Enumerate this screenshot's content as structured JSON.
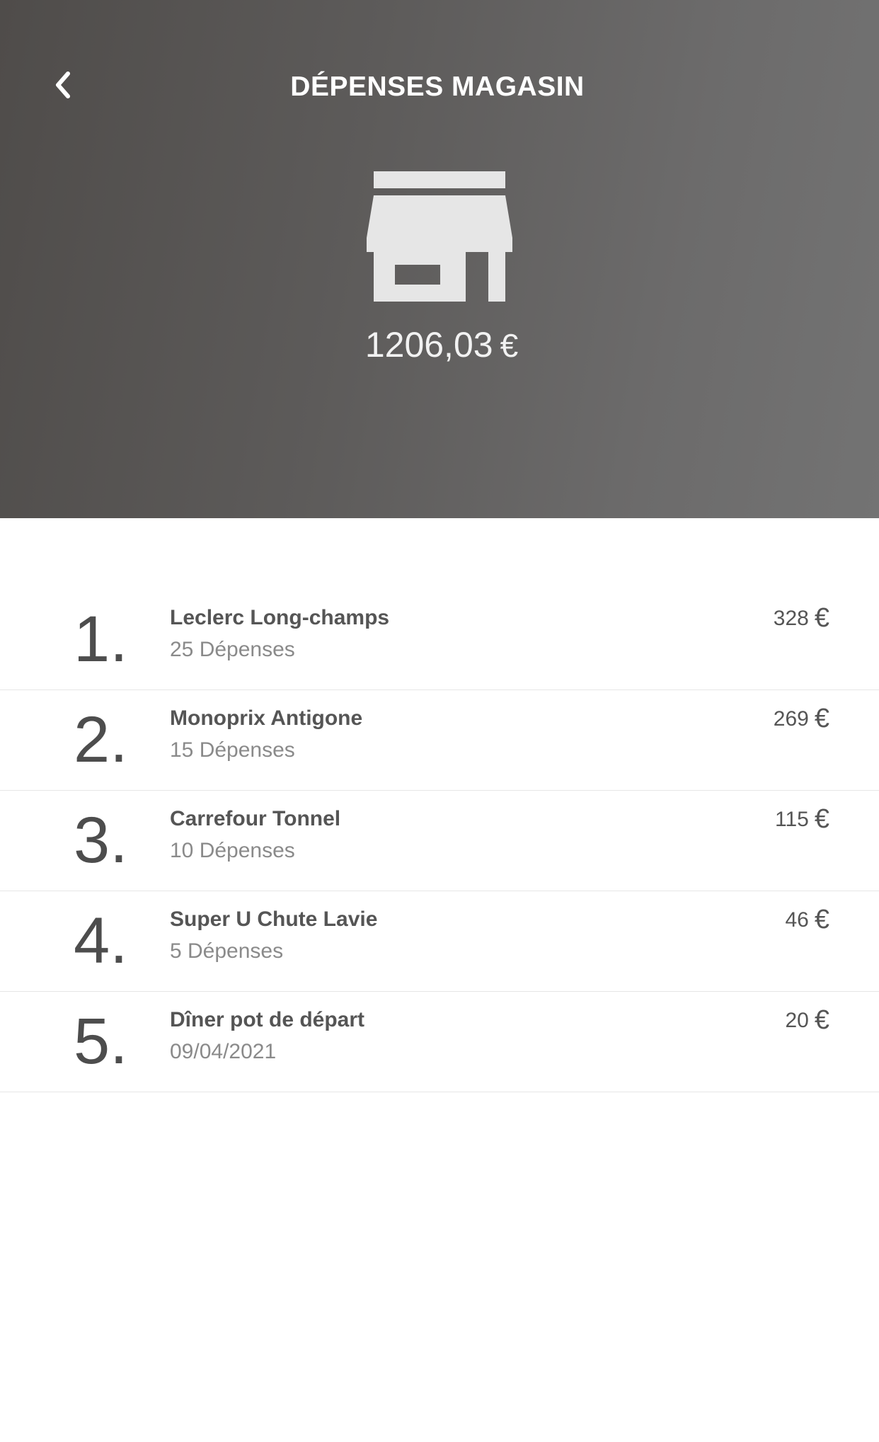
{
  "header": {
    "title": "DÉPENSES MAGASIN",
    "total_value": "1206,03",
    "currency": "€",
    "icons": {
      "back": "chevron-left-icon",
      "store": "store-icon"
    },
    "colors": {
      "gradient_start": "#4f4c4a",
      "gradient_end": "#737373",
      "icon": "#e6e6e6"
    }
  },
  "stores": [
    {
      "rank": "1.",
      "name": "Leclerc Long-champs",
      "subtitle": "25 Dépenses",
      "amount": "328",
      "currency": "€"
    },
    {
      "rank": "2.",
      "name": "Monoprix Antigone",
      "subtitle": "15 Dépenses",
      "amount": "269",
      "currency": "€"
    },
    {
      "rank": "3.",
      "name": "Carrefour Tonnel",
      "subtitle": "10 Dépenses",
      "amount": "115",
      "currency": "€"
    },
    {
      "rank": "4.",
      "name": "Super U Chute Lavie",
      "subtitle": "5 Dépenses",
      "amount": "46",
      "currency": "€"
    },
    {
      "rank": "5.",
      "name": "Dîner pot de départ",
      "subtitle": "09/04/2021",
      "amount": "20",
      "currency": "€"
    }
  ]
}
